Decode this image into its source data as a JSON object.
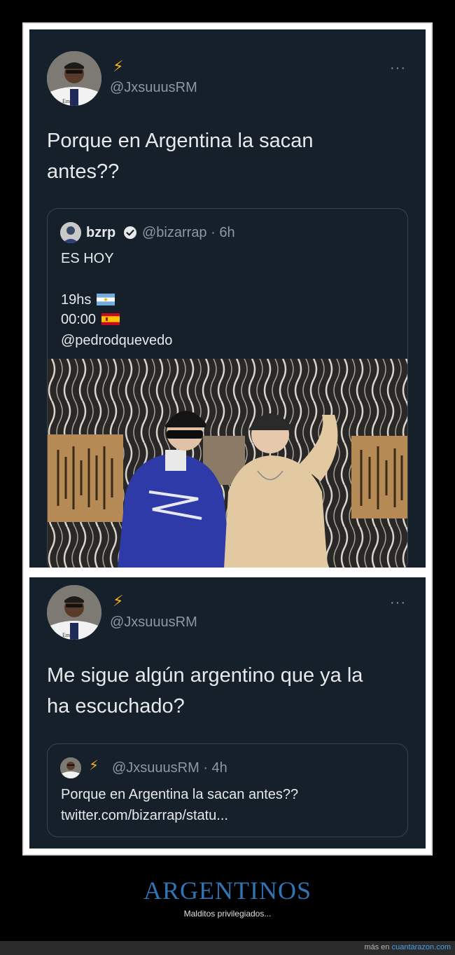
{
  "tweet1": {
    "name_emoji": "⚡",
    "handle": "@JxsuuusRM",
    "more": "···",
    "text_line1": "Porque en Argentina la sacan",
    "text_line2": "antes??",
    "quote": {
      "name": "bzrp",
      "meta": "@bizarrap · 6h",
      "line1": "ES HOY",
      "line2": "19hs",
      "line3": "00:00",
      "line4": "@pedrodquevedo"
    }
  },
  "tweet2": {
    "name_emoji": "⚡",
    "handle": "@JxsuuusRM",
    "more": "···",
    "text_line1": "Me sigue algún argentino que ya la",
    "text_line2": "ha escuchado?",
    "quote": {
      "name_emoji": "⚡",
      "meta": "@JxsuuusRM · 4h",
      "line1": "Porque en Argentina la sacan antes??",
      "line2": "twitter.com/bizarrap/statu..."
    }
  },
  "footer": {
    "title": "ARGENTINOS",
    "subtitle": "Malditos privilegiados...",
    "more_prefix": "más en ",
    "site": "cuantarazon.com"
  },
  "colors": {
    "panel": "#15202b",
    "handle": "#8b98a5",
    "title": "#2f74b5",
    "link": "#4a9ee8",
    "bolt": "#f5b21c"
  }
}
